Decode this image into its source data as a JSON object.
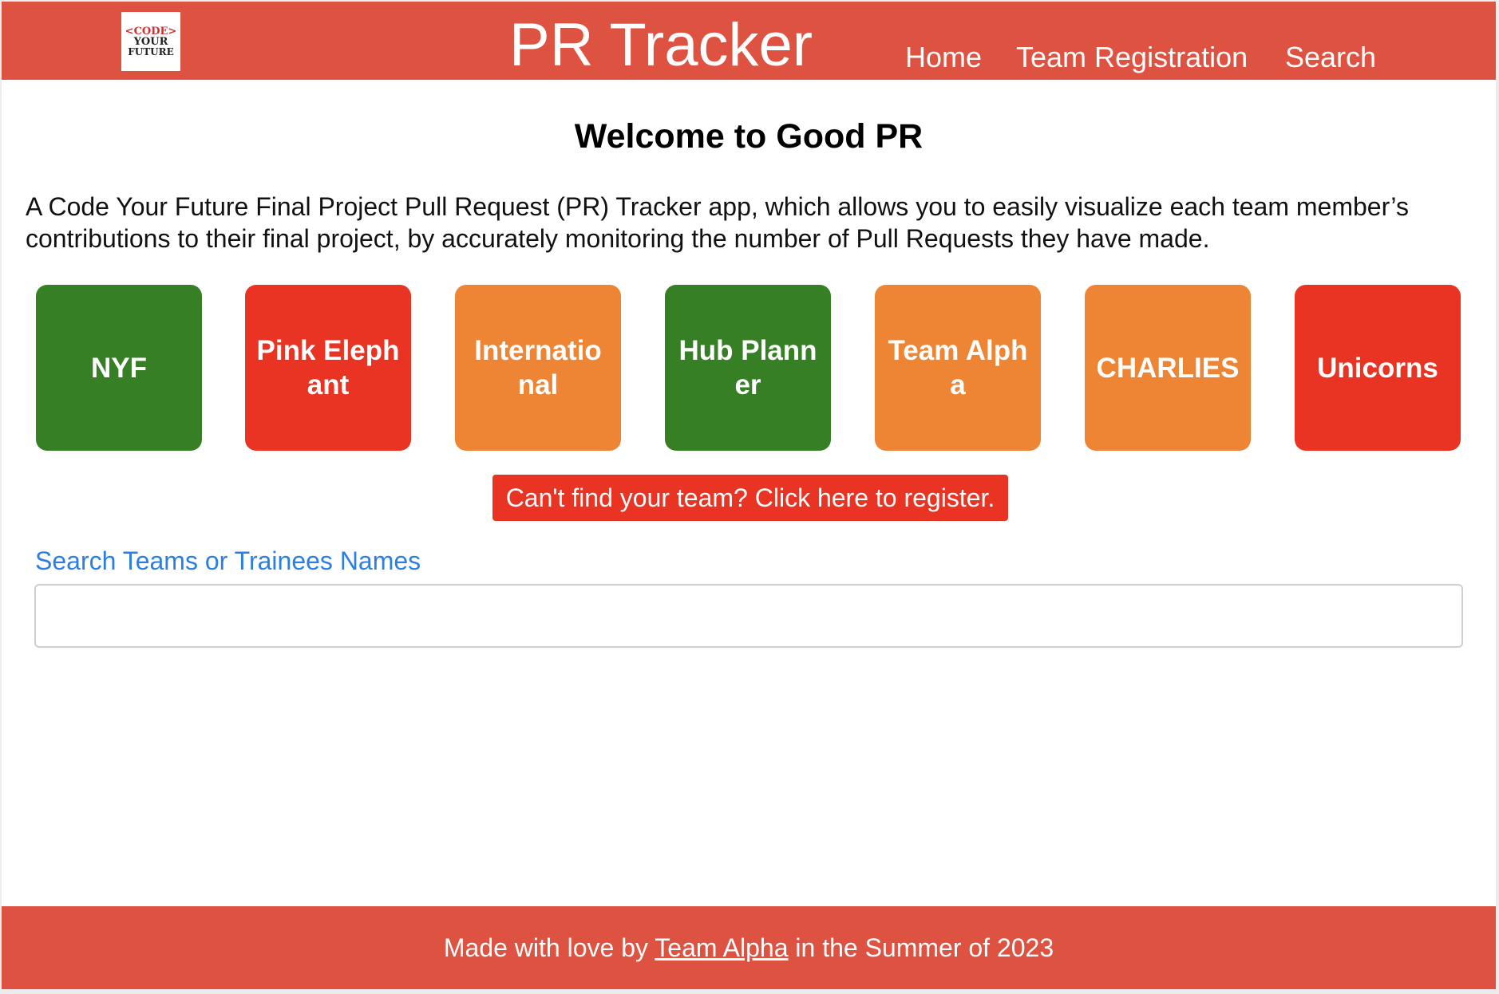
{
  "header": {
    "logo": {
      "line1": "<CODE>",
      "line2": "YOUR",
      "line3": "FUTURE"
    },
    "title": "PR Tracker",
    "nav": {
      "home": "Home",
      "team_registration": "Team Registration",
      "search": "Search"
    }
  },
  "main": {
    "heading": "Welcome to Good PR",
    "intro": "A Code Your Future Final Project Pull Request (PR) Tracker app, which allows you to easily visualize each team member’s contributions to their final project, by accurately monitoring the number of Pull Requests they have made.",
    "teams": [
      {
        "name": "NYF",
        "color": "#377f25"
      },
      {
        "name": "Pink Elephant",
        "color": "#e93323"
      },
      {
        "name": "International",
        "color": "#ee8534"
      },
      {
        "name": "Hub Planner",
        "color": "#377f25"
      },
      {
        "name": "Team Alpha",
        "color": "#ee8534"
      },
      {
        "name": "CHARLIES",
        "color": "#ee8534"
      },
      {
        "name": "Unicorns",
        "color": "#e93323"
      }
    ],
    "register_button": "Can't find your team? Click here to register.",
    "search": {
      "label": "Search Teams or Trainees Names",
      "value": "",
      "placeholder": ""
    }
  },
  "footer": {
    "prefix": "Made with love by ",
    "link": "Team Alpha",
    "suffix": " in the Summer of 2023"
  },
  "colors": {
    "header_bg": "#de5241",
    "footer_bg": "#de5241",
    "link_blue": "#2b7fe3",
    "register_bg": "#e93323"
  }
}
